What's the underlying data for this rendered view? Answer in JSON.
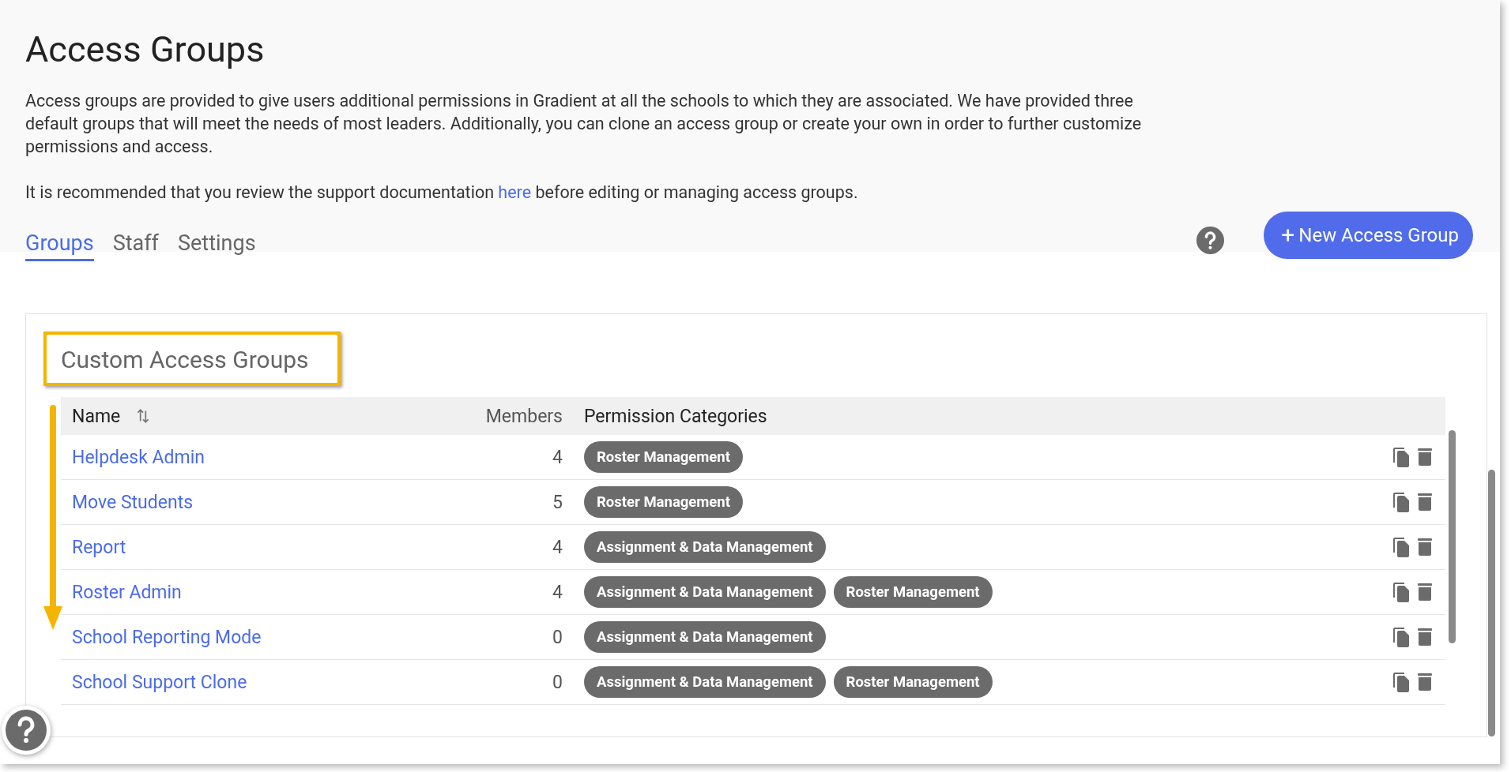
{
  "page": {
    "title": "Access Groups",
    "intro": "Access groups are provided to give users additional permissions in Gradient at all the schools to which they are associated. We have provided three default groups that will meet the needs of most leaders. Additionally, you can clone an access group or create your own in order to further customize permissions and access.",
    "note": {
      "before": "It is recommended that you review the support documentation ",
      "link": "here",
      "after": " before editing or managing access groups."
    }
  },
  "tabs": [
    {
      "label": "Groups",
      "selected": true
    },
    {
      "label": "Staff",
      "selected": false
    },
    {
      "label": "Settings",
      "selected": false
    }
  ],
  "new_button": {
    "label": "New Access Group",
    "icon": "+"
  },
  "section": {
    "title": "Custom Access Groups"
  },
  "table": {
    "columns": [
      "Name",
      "Members",
      "Permission Categories"
    ],
    "rows": [
      {
        "name": "Helpdesk Admin",
        "members": "4",
        "categories": [
          "Roster Management"
        ]
      },
      {
        "name": "Move Students",
        "members": "5",
        "categories": [
          "Roster Management"
        ]
      },
      {
        "name": "Report",
        "members": "4",
        "categories": [
          "Assignment & Data Management"
        ]
      },
      {
        "name": "Roster Admin",
        "members": "4",
        "categories": [
          "Assignment & Data Management",
          "Roster Management"
        ]
      },
      {
        "name": "School Reporting Mode",
        "members": "0",
        "categories": [
          "Assignment & Data Management"
        ]
      },
      {
        "name": "School Support Clone",
        "members": "0",
        "categories": [
          "Assignment & Data Management",
          "Roster Management"
        ]
      }
    ]
  }
}
